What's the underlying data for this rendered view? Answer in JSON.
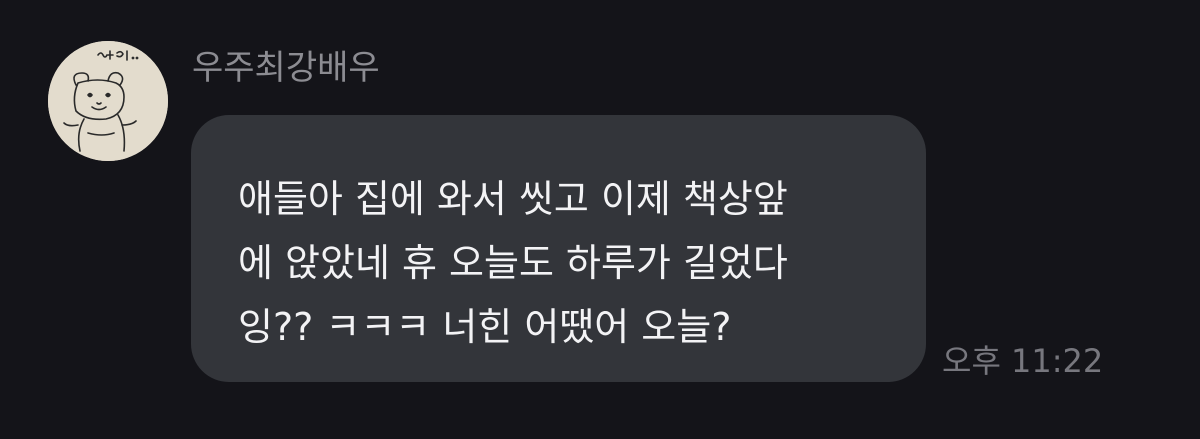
{
  "chat": {
    "sender": {
      "name": "우주최강배우",
      "avatar_icon": "bear-doodle-avatar",
      "avatar_caption": "나 안아.."
    },
    "message": {
      "lines": [
        "애들아 집에 와서 씻고 이제 책상앞",
        "에 앉았네 휴 오늘도 하루가 길었다",
        "잉?? ㅋㅋㅋ 너힌 어땠어 오늘?"
      ],
      "time": "오후 11:22"
    }
  },
  "colors": {
    "background": "#141419",
    "bubble": "#33353a",
    "message_text": "#f3f3f5",
    "sender_name": "#8c8c92",
    "timestamp": "#77777e"
  }
}
